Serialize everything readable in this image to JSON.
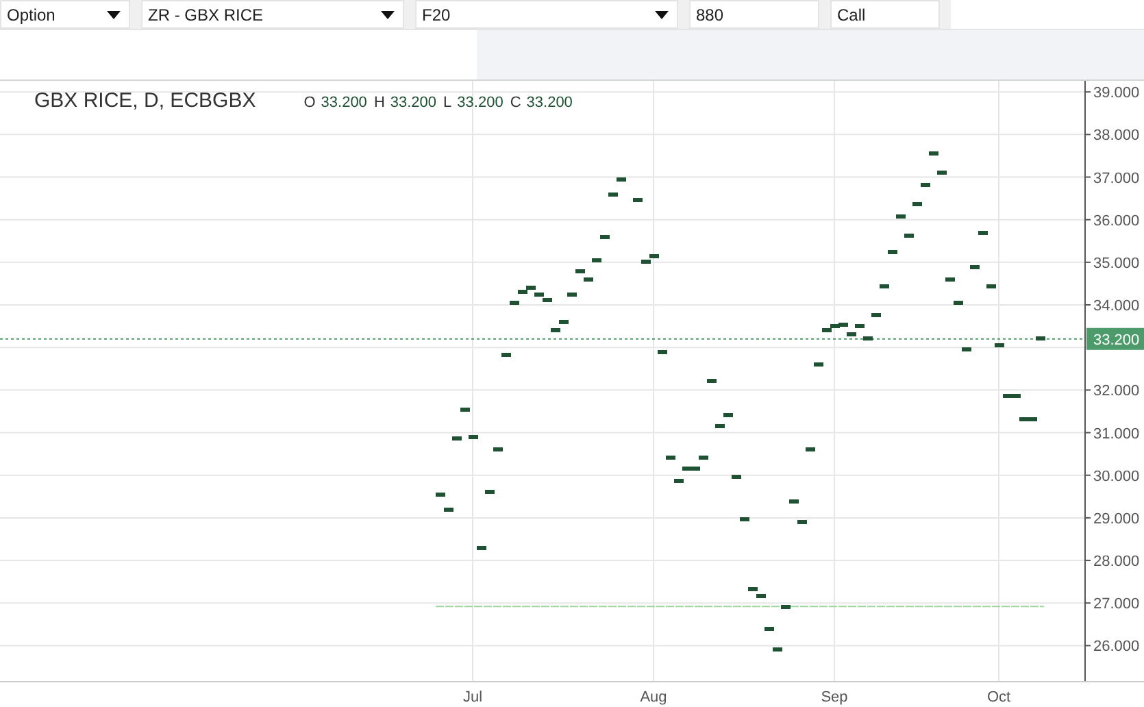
{
  "toolbar": {
    "dropdowns": [
      {
        "value": "Option"
      },
      {
        "value": "ZR - GBX RICE"
      },
      {
        "value": "F20"
      }
    ],
    "fields": [
      {
        "value": "880"
      },
      {
        "value": "Call"
      }
    ]
  },
  "chart": {
    "title": "GBX RICE, D, ECBGBX",
    "ohlc": [
      {
        "key": "O",
        "value": "33.200"
      },
      {
        "key": "H",
        "value": "33.200"
      },
      {
        "key": "L",
        "value": "33.200"
      },
      {
        "key": "C",
        "value": "33.200"
      }
    ],
    "chart_data": {
      "type": "scatter",
      "ylim": [
        25.17,
        39.26
      ],
      "grid": true,
      "categories": [
        null,
        null,
        null,
        null,
        null,
        null,
        null,
        null,
        null,
        null,
        null,
        null,
        null,
        null,
        null,
        null,
        null,
        null,
        null,
        null,
        null,
        null,
        null,
        null,
        null,
        null,
        null,
        null,
        null,
        null,
        null,
        null,
        null,
        null,
        null,
        null,
        null,
        null,
        null,
        null,
        null,
        null,
        null,
        null,
        null,
        null,
        null,
        null,
        null,
        null,
        null,
        null,
        null,
        null,
        null,
        null,
        null,
        "Jul",
        null,
        null,
        null,
        null,
        null,
        null,
        null,
        null,
        null,
        null,
        null,
        null,
        null,
        null,
        null,
        null,
        null,
        null,
        null,
        null,
        null,
        "Aug",
        null,
        null,
        null,
        null,
        null,
        null,
        null,
        null,
        null,
        null,
        null,
        null,
        null,
        null,
        null,
        null,
        null,
        null,
        null,
        null,
        null,
        "Sep",
        null,
        null,
        null,
        null,
        null,
        null,
        null,
        null,
        null,
        null,
        null,
        null,
        null,
        null,
        null,
        null,
        null,
        null,
        null,
        "Oct",
        null,
        null,
        null,
        null,
        null,
        null,
        null,
        null,
        null,
        null
      ],
      "series": [
        {
          "color": "#1e5232",
          "values": [
            null,
            null,
            null,
            null,
            null,
            null,
            null,
            null,
            null,
            null,
            null,
            null,
            null,
            null,
            null,
            null,
            null,
            null,
            null,
            null,
            null,
            null,
            null,
            null,
            null,
            null,
            null,
            null,
            null,
            null,
            null,
            null,
            null,
            null,
            null,
            null,
            null,
            null,
            null,
            null,
            null,
            null,
            null,
            null,
            null,
            null,
            null,
            null,
            null,
            null,
            null,
            null,
            null,
            29.53,
            29.18,
            30.85,
            31.53,
            30.88,
            28.28,
            29.6,
            30.62,
            32.84,
            34.04,
            34.29,
            34.39,
            34.23,
            34.1,
            33.39,
            33.59,
            34.23,
            34.78,
            34.58,
            35.03,
            35.58,
            36.58,
            36.93,
            null,
            36.45,
            35.0,
            35.13,
            32.88,
            30.4,
            29.88,
            30.17,
            30.17,
            30.4,
            32.23,
            31.14,
            31.4,
            29.95,
            28.98,
            27.34,
            27.15,
            26.38,
            25.9,
            26.92,
            29.37,
            28.89,
            30.62,
            32.59,
            33.42,
            33.49,
            33.55,
            33.3,
            33.49,
            33.21,
            33.75,
            34.45,
            35.23,
            36.09,
            35.64,
            36.35,
            36.8,
            37.57,
            37.09,
            34.58,
            34.06,
            32.97,
            34.9,
            35.68,
            34.45,
            33.04,
            31.85,
            31.85,
            31.3,
            31.3,
            33.2,
            null,
            null,
            null,
            null,
            null
          ]
        }
      ],
      "yticks": [
        {
          "value": 26,
          "label": "26.000"
        },
        {
          "value": 27,
          "label": "27.000"
        },
        {
          "value": 28,
          "label": "28.000"
        },
        {
          "value": 29,
          "label": "29.000"
        },
        {
          "value": 30,
          "label": "30.000"
        },
        {
          "value": 31,
          "label": "31.000"
        },
        {
          "value": 32,
          "label": "32.000"
        },
        {
          "value": 34,
          "label": "34.000"
        },
        {
          "value": 35,
          "label": "35.000"
        },
        {
          "value": 36,
          "label": "36.000"
        },
        {
          "value": 37,
          "label": "37.000"
        },
        {
          "value": 38,
          "label": "38.000"
        },
        {
          "value": 39,
          "label": "39.000"
        }
      ],
      "ref_lines": [
        {
          "axis": "y",
          "value": 33.2,
          "label": "33.200",
          "color": "#4d9a6a"
        },
        {
          "axis": "y",
          "value": 26.92,
          "color": "#9ed69e"
        }
      ]
    }
  }
}
